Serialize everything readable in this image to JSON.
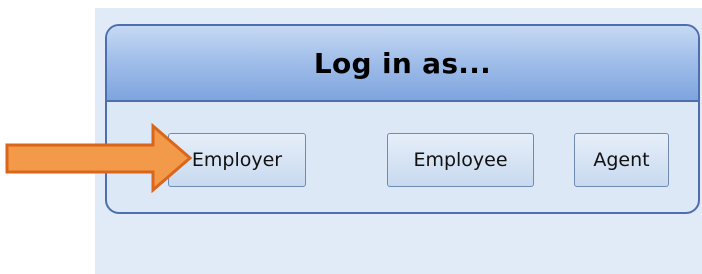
{
  "dialog": {
    "title": "Log in as..."
  },
  "buttons": {
    "employer": "Employer",
    "employee": "Employee",
    "agent": "Agent"
  },
  "annotation": {
    "icon": "arrow-right-icon",
    "color": "#f39a4a",
    "outline_color": "#d9661a"
  }
}
